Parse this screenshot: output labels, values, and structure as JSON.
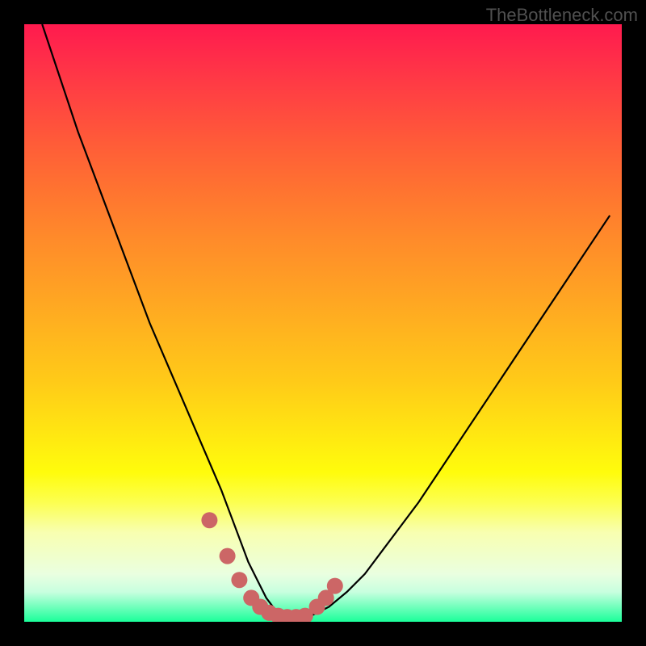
{
  "watermark": "TheBottleneck.com",
  "chart_data": {
    "type": "line",
    "title": "",
    "xlabel": "",
    "ylabel": "",
    "xlim": [
      0,
      100
    ],
    "ylim": [
      0,
      100
    ],
    "series": [
      {
        "name": "bottleneck-curve",
        "x": [
          3,
          6,
          9,
          12,
          15,
          18,
          21,
          24,
          27,
          30,
          33,
          34.5,
          36,
          37.5,
          39,
          40.5,
          42,
          43.5,
          45,
          48,
          51,
          54,
          57,
          60,
          63,
          66,
          70,
          74,
          78,
          82,
          86,
          90,
          94,
          98
        ],
        "values": [
          100,
          91,
          82,
          74,
          66,
          58,
          50,
          43,
          36,
          29,
          22,
          18,
          14,
          10,
          7,
          4,
          2,
          1,
          0.5,
          1,
          2.5,
          5,
          8,
          12,
          16,
          20,
          26,
          32,
          38,
          44,
          50,
          56,
          62,
          68
        ]
      }
    ],
    "markers": {
      "name": "data-points",
      "color": "#cc6666",
      "x": [
        31,
        34,
        36,
        38,
        39.5,
        41,
        42.5,
        44,
        45.5,
        47,
        49,
        50.5,
        52
      ],
      "values": [
        17,
        11,
        7,
        4,
        2.5,
        1.5,
        1,
        0.8,
        0.8,
        1,
        2.5,
        4,
        6
      ]
    },
    "gradient_stops": [
      {
        "pos": 0,
        "color": "#ff1a4e"
      },
      {
        "pos": 50,
        "color": "#ffb020"
      },
      {
        "pos": 75,
        "color": "#fffc0c"
      },
      {
        "pos": 100,
        "color": "#1bff9a"
      }
    ]
  }
}
